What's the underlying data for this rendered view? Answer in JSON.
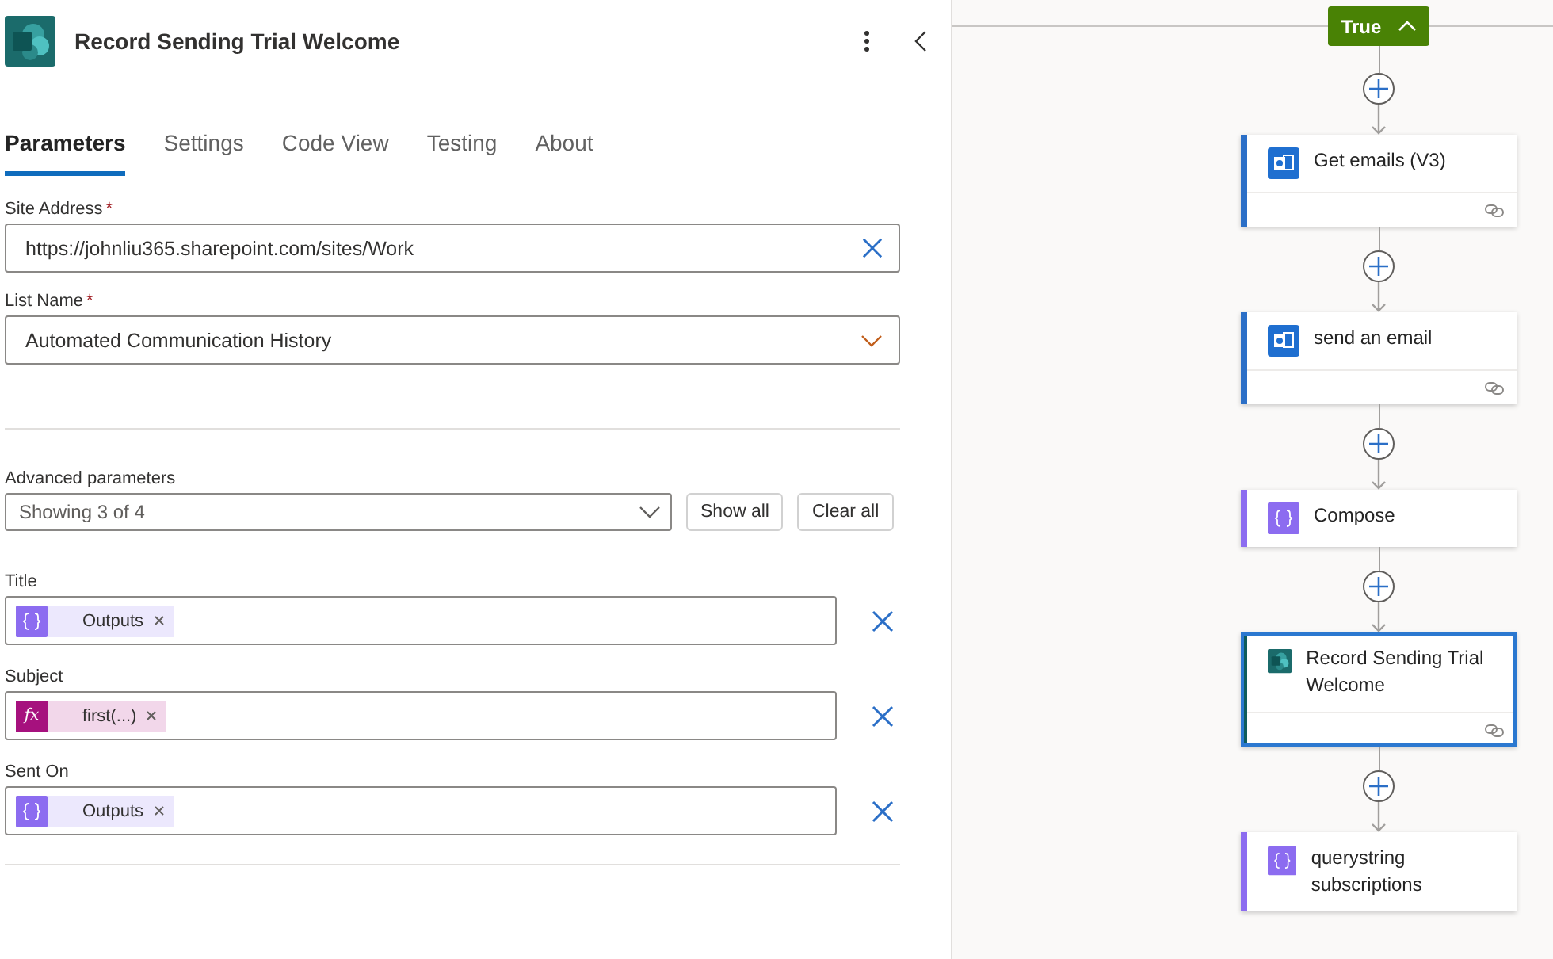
{
  "panel": {
    "title": "Record Sending Trial Welcome",
    "tabs": [
      {
        "label": "Parameters",
        "selected": true
      },
      {
        "label": "Settings",
        "selected": false
      },
      {
        "label": "Code View",
        "selected": false
      },
      {
        "label": "Testing",
        "selected": false
      },
      {
        "label": "About",
        "selected": false
      }
    ],
    "site_address": {
      "label": "Site Address",
      "required_mark": "*",
      "value": "https://johnliu365.sharepoint.com/sites/Work"
    },
    "list_name": {
      "label": "List Name",
      "required_mark": "*",
      "value": "Automated Communication History"
    },
    "advanced": {
      "label": "Advanced parameters",
      "value": "Showing 3 of 4",
      "buttons": [
        "Show all",
        "Clear all"
      ]
    },
    "parameters": [
      {
        "label": "Title",
        "token": {
          "kind": "variable",
          "text": "Outputs"
        }
      },
      {
        "label": "Subject",
        "token": {
          "kind": "expression",
          "symbol": "fx",
          "text": "first(...)"
        }
      },
      {
        "label": "Sent On",
        "token": {
          "kind": "variable",
          "text": "Outputs"
        }
      }
    ]
  },
  "canvas": {
    "branch": {
      "label": "True",
      "expanded": true
    },
    "actions": [
      {
        "title": "Get emails (V3)",
        "kind": "outlook",
        "selected": false
      },
      {
        "title": "send an email",
        "kind": "outlook",
        "selected": false
      },
      {
        "title": "Compose",
        "kind": "compose",
        "selected": false
      },
      {
        "title": "Record Sending Trial Welcome",
        "kind": "sharepoint",
        "selected": true
      },
      {
        "title": "querystring subscriptions",
        "kind": "compose",
        "selected": false
      }
    ]
  }
}
